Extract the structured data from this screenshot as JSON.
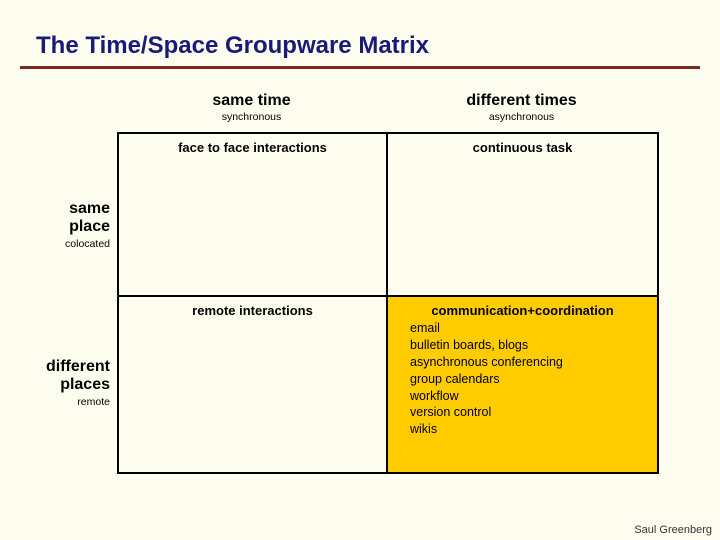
{
  "title": "The Time/Space Groupware Matrix",
  "columns": [
    {
      "label": "same time",
      "sub": "synchronous"
    },
    {
      "label": "different times",
      "sub": "asynchronous"
    }
  ],
  "rows": [
    {
      "label_line1": "same",
      "label_line2": "place",
      "sub": "colocated"
    },
    {
      "label_line1": "different",
      "label_line2": "places",
      "sub": "remote"
    }
  ],
  "cells": {
    "q1": {
      "head": "face to face interactions",
      "items": []
    },
    "q2": {
      "head": "continuous task",
      "items": []
    },
    "q3": {
      "head": "remote interactions",
      "items": []
    },
    "q4": {
      "head": "communication+coordination",
      "items": [
        "email",
        "bulletin boards, blogs",
        "asynchronous conferencing",
        "group calendars",
        "workflow",
        "version control",
        "wikis"
      ]
    }
  },
  "credit": "Saul Greenberg"
}
